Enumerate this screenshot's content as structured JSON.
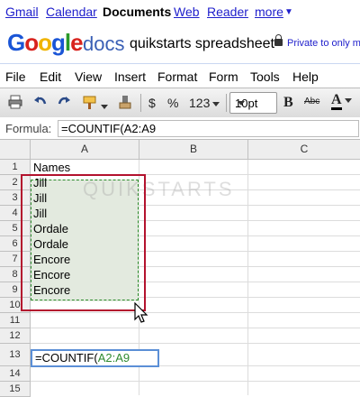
{
  "gbar": {
    "links": [
      "Gmail",
      "Calendar",
      "Documents",
      "Web",
      "Reader",
      "more"
    ],
    "current": "Documents"
  },
  "app": {
    "logo": "Google",
    "product": "docs",
    "doc_title": "quikstarts spreadsheet",
    "privacy": "Private to only m"
  },
  "menu": [
    "File",
    "Edit",
    "View",
    "Insert",
    "Format",
    "Form",
    "Tools",
    "Help"
  ],
  "toolbar": {
    "currency": "$",
    "percent": "%",
    "number_format": "123",
    "font_size": "10pt",
    "bold": "B",
    "strike": "Abc",
    "text_color": "A"
  },
  "formula_bar": {
    "label": "Formula:",
    "value": "=COUNTIF(A2:A9"
  },
  "grid": {
    "columns": [
      "A",
      "B",
      "C"
    ],
    "rows": [
      "1",
      "2",
      "3",
      "4",
      "5",
      "6",
      "7",
      "8",
      "9",
      "10",
      "11",
      "12",
      "13",
      "14",
      "15"
    ],
    "cells_A": [
      "Names",
      "Jill",
      "Jill",
      "Jill",
      "Ordale",
      "Ordale",
      "Encore",
      "Encore",
      "Encore"
    ],
    "edit_cell": {
      "prefix": "=COUNTIF(",
      "range": "A2:A9"
    },
    "watermark": "QUIKSTARTS"
  },
  "colors": {
    "link": "#2020cc",
    "selection_box": "#b3122e",
    "selection_fill": "#e3eadf",
    "range_text": "#2f8a2f",
    "edit_border": "#5b8fd6"
  }
}
